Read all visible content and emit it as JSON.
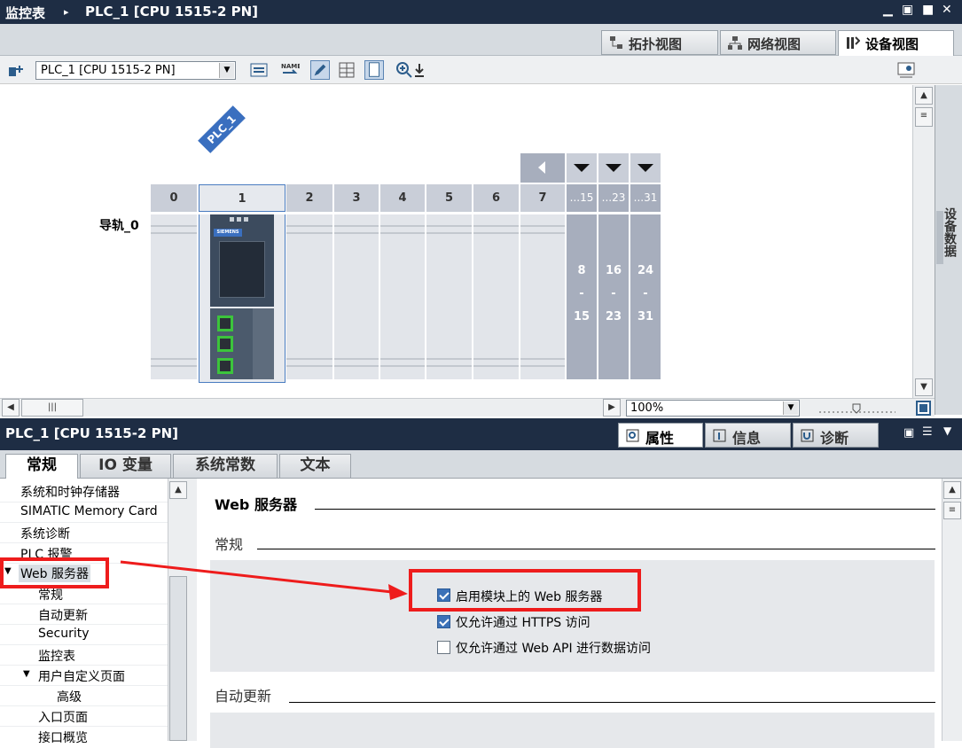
{
  "titlebar": {
    "crumb1": "监控表",
    "sep": "▸",
    "crumb2": "PLC_1 [CPU 1515-2 PN]"
  },
  "view_tabs": [
    "拓扑视图",
    "网络视图",
    "设备视图"
  ],
  "toolbar": {
    "device_select": "PLC_1 [CPU 1515-2 PN]"
  },
  "canvas": {
    "plc_tag": "PLC_1",
    "rail_label": "导轨_0",
    "slots": [
      "0",
      "1",
      "2",
      "3",
      "4",
      "5",
      "6",
      "7"
    ],
    "groups": [
      {
        "head": "...15",
        "from": "8",
        "dash": "-",
        "to": "15"
      },
      {
        "head": "...23",
        "from": "16",
        "dash": "-",
        "to": "23"
      },
      {
        "head": "...31",
        "from": "24",
        "dash": "-",
        "to": "31"
      }
    ],
    "module_brand": "SIEMENS"
  },
  "side_panel_label": "设备数据",
  "zoom": {
    "value": "100%"
  },
  "properties": {
    "title": "PLC_1 [CPU 1515-2 PN]",
    "tabs": [
      "属性",
      "信息",
      "诊断"
    ],
    "subtabs": [
      "常规",
      "IO 变量",
      "系统常数",
      "文本"
    ]
  },
  "nav": {
    "items": [
      "系统和时钟存储器",
      "SIMATIC Memory Card",
      "系统诊断",
      "PLC 报警",
      "Web 服务器",
      "常规",
      "自动更新",
      "Security",
      "监控表",
      "用户自定义页面",
      "高级",
      "入口页面",
      "接口概览"
    ]
  },
  "content": {
    "section_title": "Web 服务器",
    "sub_general": "常规",
    "checkboxes": [
      {
        "label": "启用模块上的 Web 服务器",
        "checked": true
      },
      {
        "label": "仅允许通过 HTTPS 访问",
        "checked": true
      },
      {
        "label": "仅允许通过 Web API 进行数据访问",
        "checked": false
      }
    ],
    "sub_autoupdate": "自动更新"
  },
  "colors": {
    "titlebar": "#1e2d44",
    "accent": "#3b71b8",
    "highlight": "#ee1c1c"
  }
}
